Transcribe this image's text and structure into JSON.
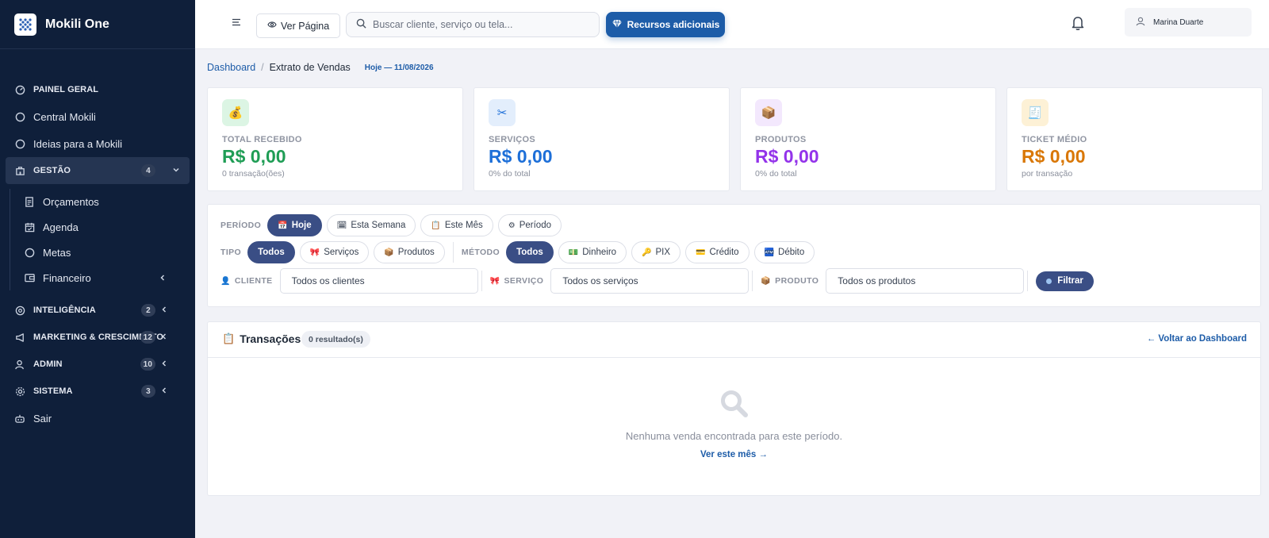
{
  "app": {
    "name": "Mokili One"
  },
  "sidebar": {
    "items": [
      {
        "label": "PAINEL GERAL",
        "icon": "dashboard-icon"
      },
      {
        "label": "Central Mokili",
        "icon": "circle-icon"
      },
      {
        "label": "Ideias para a Mokili",
        "icon": "circle-icon"
      },
      {
        "label": "GESTÃO",
        "icon": "building-icon",
        "badge": "4",
        "expanded": true
      },
      {
        "label": "INTELIGÊNCIA",
        "icon": "brain-icon",
        "badge": "2"
      },
      {
        "label": "MARKETING & CRESCIMENTO",
        "icon": "megaphone-icon",
        "badge": "12"
      },
      {
        "label": "ADMIN",
        "icon": "user-icon",
        "badge": "10"
      },
      {
        "label": "SISTEMA",
        "icon": "gear-icon",
        "badge": "3"
      },
      {
        "label": "Sair",
        "icon": "logout-icon"
      }
    ],
    "gestao_children": [
      {
        "label": "Orçamentos",
        "icon": "document-icon"
      },
      {
        "label": "Agenda",
        "icon": "calendar-icon"
      },
      {
        "label": "Metas",
        "icon": "circle-icon"
      },
      {
        "label": "Financeiro",
        "icon": "wallet-icon"
      }
    ]
  },
  "topbar": {
    "view_page_label": "Ver Página",
    "search_placeholder": "Buscar cliente, serviço ou tela...",
    "resources_label": "Recursos adicionais",
    "user_name": "Marina Duarte"
  },
  "breadcrumb": {
    "root": "Dashboard",
    "separator": "/",
    "current": "Extrato de Vendas",
    "date_badge": "Hoje — 11/08/2026"
  },
  "stats": [
    {
      "label": "TOTAL RECEBIDO",
      "value": "R$ 0,00",
      "sub": "0 transação(ões)",
      "color": "#1f9d55",
      "icon_bg": "#dcf5e4",
      "icon": "money-bag-icon",
      "glyph": "💰"
    },
    {
      "label": "SERVIÇOS",
      "value": "R$ 0,00",
      "sub": "0% do total",
      "color": "#1d6fd8",
      "icon_bg": "#e3eefc",
      "icon": "scissors-icon",
      "glyph": "✂"
    },
    {
      "label": "PRODUTOS",
      "value": "R$ 0,00",
      "sub": "0% do total",
      "color": "#9333ea",
      "icon_bg": "#f3e8fd",
      "icon": "box-icon",
      "glyph": "📦"
    },
    {
      "label": "TICKET MÉDIO",
      "value": "R$ 0,00",
      "sub": "por transação",
      "color": "#d97706",
      "icon_bg": "#fdf1d6",
      "icon": "receipt-icon",
      "glyph": "🧾"
    }
  ],
  "filters": {
    "periodo": {
      "label": "PERÍODO",
      "options": [
        {
          "label": "Hoje",
          "glyph": "📅",
          "selected": true
        },
        {
          "label": "Esta Semana",
          "glyph": "🗓",
          "selected": false
        },
        {
          "label": "Este Mês",
          "glyph": "📋",
          "selected": false
        },
        {
          "label": "Período",
          "glyph": "⚙",
          "selected": false
        }
      ]
    },
    "tipo": {
      "label": "TIPO",
      "options": [
        {
          "label": "Todos",
          "glyph": "",
          "selected": true
        },
        {
          "label": "Serviços",
          "glyph": "🎀",
          "selected": false
        },
        {
          "label": "Produtos",
          "glyph": "📦",
          "selected": false
        }
      ]
    },
    "metodo": {
      "label": "MÉTODO",
      "options": [
        {
          "label": "Todos",
          "glyph": "",
          "selected": true
        },
        {
          "label": "Dinheiro",
          "glyph": "💵",
          "selected": false
        },
        {
          "label": "PIX",
          "glyph": "🔑",
          "selected": false
        },
        {
          "label": "Crédito",
          "glyph": "💳",
          "selected": false
        },
        {
          "label": "Débito",
          "glyph": "🏧",
          "selected": false
        }
      ]
    },
    "cliente": {
      "label": "CLIENTE",
      "glyph": "👤",
      "value": "Todos os clientes"
    },
    "servico": {
      "label": "SERVIÇO",
      "glyph": "🎀",
      "value": "Todos os serviços"
    },
    "produto": {
      "label": "PRODUTO",
      "glyph": "📦",
      "value": "Todos os produtos"
    },
    "filter_button": "Filtrar"
  },
  "transactions": {
    "title": "Transações",
    "title_glyph": "📋",
    "count": "0 resultado(s)",
    "back_link": "← Voltar ao Dashboard",
    "empty_message": "Nenhuma venda encontrada para este período.",
    "empty_link": "Ver este mês →"
  },
  "colors": {
    "sidebar_bg": "#0f1f3a",
    "accent": "#1d5ca8",
    "pill_active": "#3a4e85"
  }
}
